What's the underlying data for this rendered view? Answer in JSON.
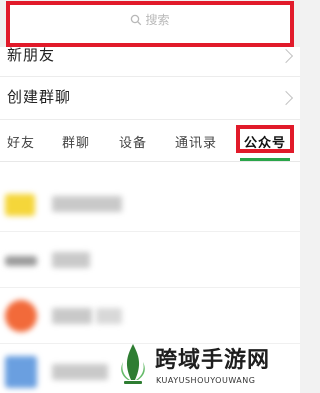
{
  "search": {
    "placeholder": "搜索"
  },
  "rows": {
    "new_friends": "新朋友",
    "create_group": "创建群聊"
  },
  "tabs": [
    {
      "label": "好友"
    },
    {
      "label": "群聊"
    },
    {
      "label": "设备"
    },
    {
      "label": "通讯录"
    },
    {
      "label": "公众号"
    }
  ],
  "active_tab": "公众号",
  "colors": {
    "highlight": "#e11a2a",
    "accent": "#2aa54a"
  },
  "list": {
    "avatar_colors": [
      "#f5d63a",
      "#9a9a9a",
      "#f26a3a",
      "#6a9fe0"
    ]
  },
  "watermark": {
    "title": "跨域手游网",
    "subtitle": "KUAYUSHOUYOUWANG"
  }
}
